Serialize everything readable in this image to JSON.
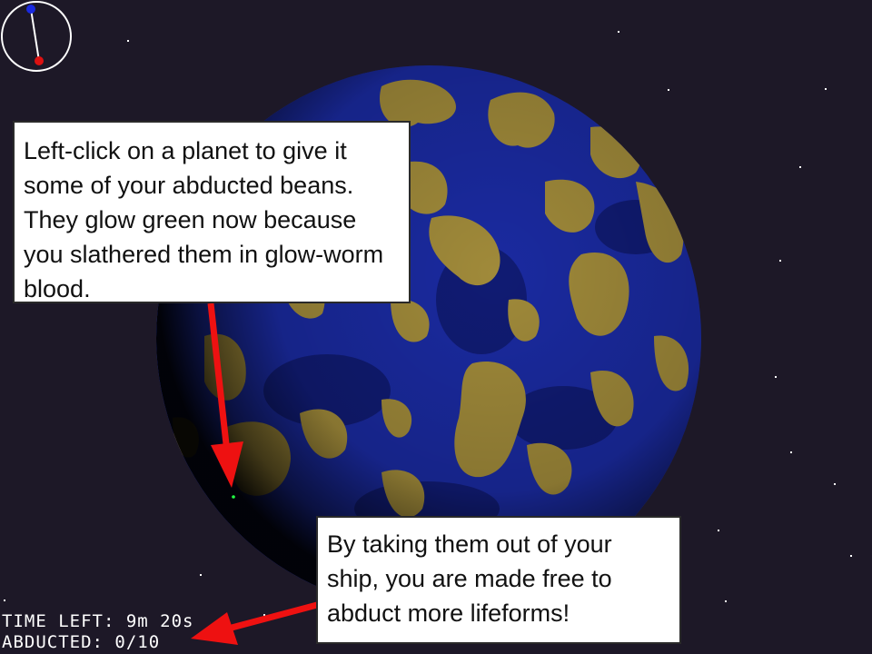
{
  "tooltips": {
    "give_beans": "Left-click on a planet to give it some of your abducted beans. They glow green now because you slathered them in glow-worm blood.",
    "free_ship": "By taking them out of your ship, you are made free to abduct more lifeforms!"
  },
  "hud": {
    "time_left_label": "TIME LEFT:",
    "time_left_value": "9m 20s",
    "abducted_label": "ABDUCTED:",
    "abducted_value": "0/10"
  },
  "colors": {
    "space": "#1d1827",
    "ocean": "#1a2aa0",
    "land": "#a08a3a",
    "arrow": "#ee1111",
    "compass_north": "#1a2ae0",
    "compass_ship": "#dd1111",
    "glow_bean": "#22ff44"
  },
  "icons": {
    "compass": "compass-icon",
    "bean": "glowing-bean-icon"
  }
}
